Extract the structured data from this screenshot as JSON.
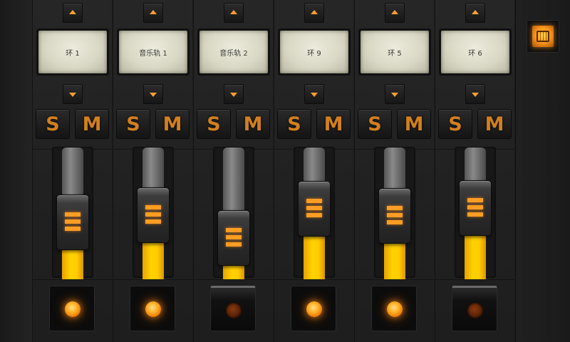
{
  "channels": [
    {
      "name": "环 1",
      "solo": "S",
      "mute": "M",
      "level": 0.38,
      "led": "on"
    },
    {
      "name": "音乐轨 1",
      "solo": "S",
      "mute": "M",
      "level": 0.48,
      "led": "on"
    },
    {
      "name": "音乐轨 2",
      "solo": "S",
      "mute": "M",
      "level": 0.18,
      "led": "off"
    },
    {
      "name": "环 9",
      "solo": "S",
      "mute": "M",
      "level": 0.56,
      "led": "on"
    },
    {
      "name": "环 5",
      "solo": "S",
      "mute": "M",
      "level": 0.47,
      "led": "on"
    },
    {
      "name": "环 6",
      "solo": "S",
      "mute": "M",
      "level": 0.57,
      "led": "off"
    }
  ],
  "corner_button": {
    "icon": "mixer-icon"
  },
  "colors": {
    "accent": "#ff9f2d",
    "fill": "#ffcc00",
    "lcd": "#dcdcc8"
  }
}
